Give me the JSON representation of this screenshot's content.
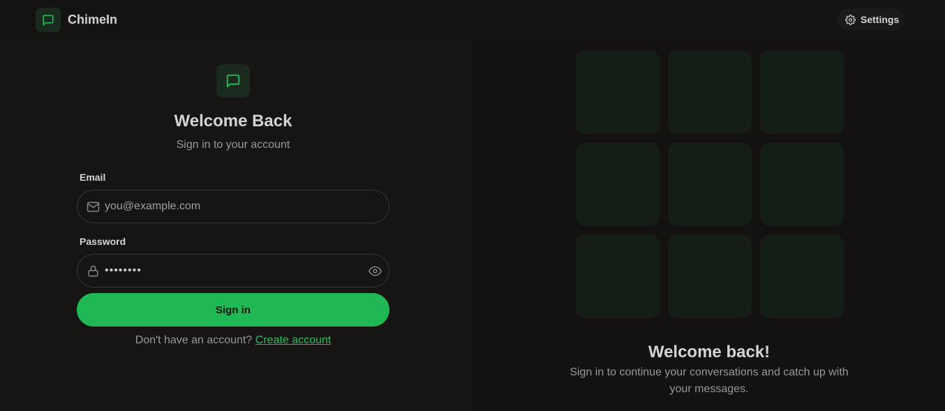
{
  "header": {
    "brand_name": "ChimeIn",
    "brand_icon": "chat-bubble-icon",
    "settings_label": "Settings",
    "settings_icon": "gear-icon"
  },
  "form": {
    "logo_icon": "chat-bubble-icon",
    "title": "Welcome Back",
    "subtitle": "Sign in to your account",
    "email": {
      "label": "Email",
      "placeholder": "you@example.com",
      "value": "",
      "icon": "mail-icon"
    },
    "password": {
      "label": "Password",
      "value": "••••••••",
      "icon": "lock-icon",
      "toggle_icon": "eye-icon"
    },
    "submit_label": "Sign in",
    "signup_prompt": "Don't have an account?",
    "signup_link": "Create account"
  },
  "promo": {
    "title": "Welcome back!",
    "text": "Sign in to continue your conversations and catch up with your messages."
  },
  "colors": {
    "accent": "#1fb855",
    "link": "#22c35c",
    "background": "#141211",
    "panel": "#171514",
    "tile": "#151d17"
  }
}
